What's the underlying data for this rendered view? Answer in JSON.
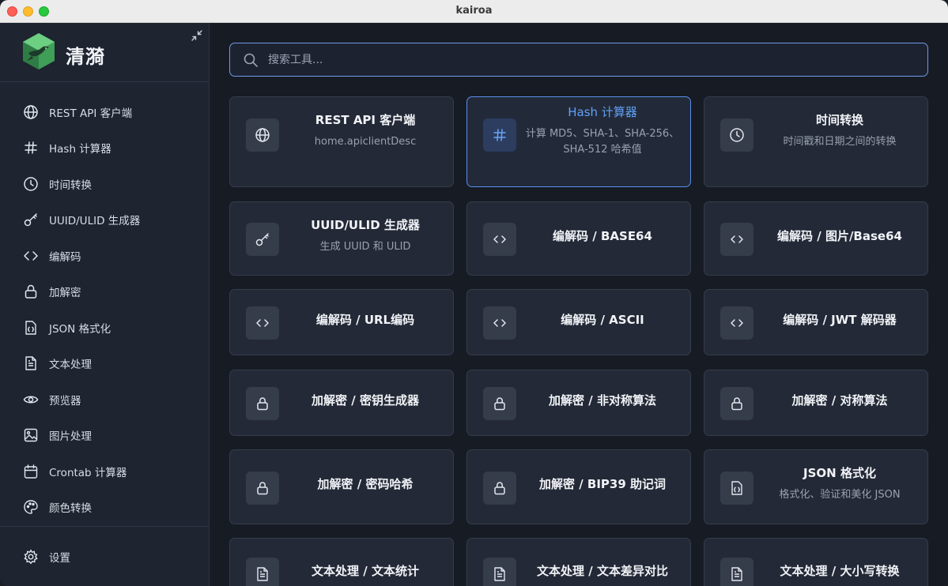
{
  "window": {
    "title": "kairoa"
  },
  "sidebar": {
    "brand": "清漪",
    "items": [
      {
        "label": "REST API 客户端",
        "icon": "globe-icon"
      },
      {
        "label": "Hash 计算器",
        "icon": "hash-icon"
      },
      {
        "label": "时间转换",
        "icon": "clock-icon"
      },
      {
        "label": "UUID/ULID 生成器",
        "icon": "key-icon"
      },
      {
        "label": "编解码",
        "icon": "code-icon"
      },
      {
        "label": "加解密",
        "icon": "lock-icon"
      },
      {
        "label": "JSON 格式化",
        "icon": "json-file-icon"
      },
      {
        "label": "文本处理",
        "icon": "document-icon"
      },
      {
        "label": "预览器",
        "icon": "eye-icon"
      },
      {
        "label": "图片处理",
        "icon": "image-icon"
      },
      {
        "label": "Crontab 计算器",
        "icon": "calendar-icon"
      },
      {
        "label": "颜色转换",
        "icon": "palette-icon"
      }
    ],
    "settings_label": "设置"
  },
  "search": {
    "placeholder": "搜索工具..."
  },
  "cards": [
    {
      "title": "REST API 客户端",
      "desc": "home.apiclientDesc",
      "icon": "globe-icon"
    },
    {
      "title": "Hash 计算器",
      "desc": "计算 MD5、SHA-1、SHA-256、SHA-512 哈希值",
      "icon": "hash-icon",
      "active": true
    },
    {
      "title": "时间转换",
      "desc": "时间戳和日期之间的转换",
      "icon": "clock-icon"
    },
    {
      "title": "UUID/ULID 生成器",
      "desc": "生成 UUID 和 ULID",
      "icon": "key-icon"
    },
    {
      "title": "编解码 / BASE64",
      "desc": "",
      "icon": "code-icon"
    },
    {
      "title": "编解码 / 图片/Base64",
      "desc": "",
      "icon": "code-icon"
    },
    {
      "title": "编解码 / URL编码",
      "desc": "",
      "icon": "code-icon"
    },
    {
      "title": "编解码 / ASCII",
      "desc": "",
      "icon": "code-icon"
    },
    {
      "title": "编解码 / JWT 解码器",
      "desc": "",
      "icon": "code-icon"
    },
    {
      "title": "加解密 / 密钥生成器",
      "desc": "",
      "icon": "lock-icon"
    },
    {
      "title": "加解密 / 非对称算法",
      "desc": "",
      "icon": "lock-icon"
    },
    {
      "title": "加解密 / 对称算法",
      "desc": "",
      "icon": "lock-icon"
    },
    {
      "title": "加解密 / 密码哈希",
      "desc": "",
      "icon": "lock-icon"
    },
    {
      "title": "加解密 / BIP39 助记词",
      "desc": "",
      "icon": "lock-icon"
    },
    {
      "title": "JSON 格式化",
      "desc": "格式化、验证和美化 JSON",
      "icon": "json-file-icon"
    },
    {
      "title": "文本处理 / 文本统计",
      "desc": "",
      "icon": "document-icon"
    },
    {
      "title": "文本处理 / 文本差异对比",
      "desc": "",
      "icon": "document-icon"
    },
    {
      "title": "文本处理 / 大小写转换",
      "desc": "",
      "icon": "document-icon"
    }
  ],
  "colors": {
    "accent": "#5b8ee8",
    "active_title": "#63a0f5",
    "background": "#171b24",
    "card": "#232936"
  }
}
